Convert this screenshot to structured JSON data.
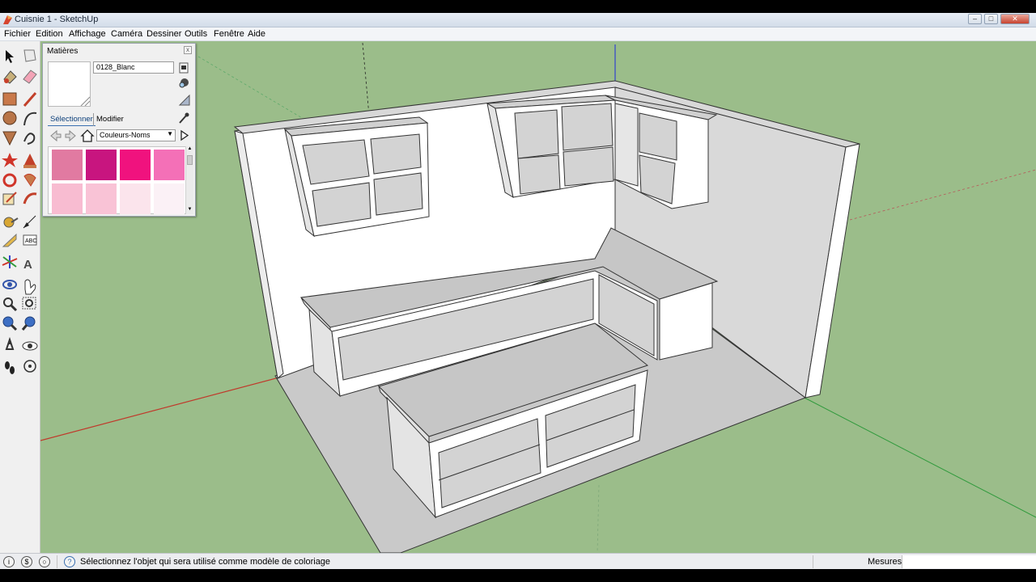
{
  "window": {
    "title": "Cuisnie 1 - SketchUp",
    "controls": [
      "minimize-icon",
      "maximize-icon",
      "close-icon"
    ]
  },
  "menu": [
    "Fichier",
    "Edition",
    "Affichage",
    "Caméra",
    "Dessiner",
    "Outils",
    "Fenêtre",
    "Aide"
  ],
  "materials_panel": {
    "title": "Matières",
    "material_name": "0128_Blanc",
    "tabs": [
      {
        "label": "Sélectionner",
        "active": true
      },
      {
        "label": "Modifier",
        "active": false
      }
    ],
    "library": "Couleurs-Noms",
    "swatch_colors": [
      "#e17aa1",
      "#c8157f",
      "#f0127e",
      "#f470b7",
      "#f8bcd1",
      "#f9c3d6",
      "#fbe4ec",
      "#fbf1f6"
    ]
  },
  "status": {
    "message": "Sélectionnez l'objet qui sera utilisé comme modèle de coloriage",
    "measures_label": "Mesures",
    "measures_value": ""
  },
  "colors": {
    "sky_ground": "#9bbd8a",
    "red_axis": "#c0392b",
    "green_axis": "#2f9a3c",
    "blue_axis": "#3344cc"
  }
}
